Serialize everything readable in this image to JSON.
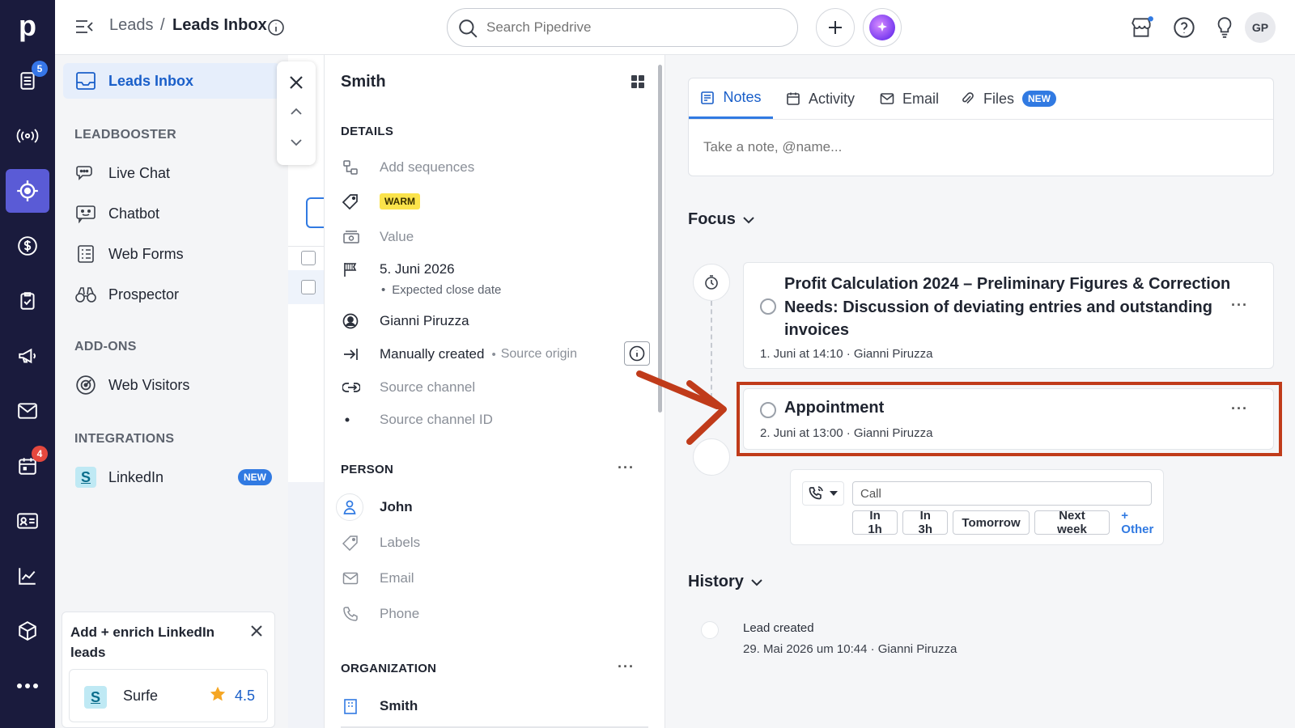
{
  "app": {
    "logo": "p",
    "colors": {
      "rail": "#1a1b3d",
      "rail_active": "#5a5bd6",
      "accent": "#317ae2",
      "badge": "#e5483e",
      "warm": "#fbe34b",
      "highlight": "#c03b1a"
    }
  },
  "rail": {
    "items": [
      {
        "icon": "leads-list-icon",
        "badge": "5",
        "badge_color": "#3676e8"
      },
      {
        "icon": "broadcast-icon"
      },
      {
        "icon": "target-icon",
        "active": true
      },
      {
        "icon": "dollar-icon"
      },
      {
        "icon": "clipboard-check-icon"
      },
      {
        "icon": "megaphone-icon"
      },
      {
        "icon": "mail-icon"
      },
      {
        "icon": "calendar-icon",
        "badge": "4",
        "badge_color": "#e5483e"
      },
      {
        "icon": "contact-card-icon"
      },
      {
        "icon": "chart-icon"
      },
      {
        "icon": "box-icon"
      },
      {
        "icon": "more-icon"
      }
    ]
  },
  "topbar": {
    "breadcrumb_parent": "Leads",
    "breadcrumb_sep": "/",
    "breadcrumb_current": "Leads Inbox",
    "search_placeholder": "Search Pipedrive",
    "avatar_initials": "GP"
  },
  "menu": {
    "inbox_label": "Leads Inbox",
    "leadbooster_heading": "LEADBOOSTER",
    "leadbooster_items": [
      "Live Chat",
      "Chatbot",
      "Web Forms",
      "Prospector"
    ],
    "addons_heading": "ADD-ONS",
    "addons_items": [
      "Web Visitors"
    ],
    "integrations_heading": "INTEGRATIONS",
    "integrations_items": [
      {
        "label": "LinkedIn",
        "badge": "NEW"
      }
    ],
    "promo": {
      "title": "Add + enrich LinkedIn leads",
      "app_name": "Surfe",
      "rating": "4.5"
    }
  },
  "details": {
    "title": "Smith",
    "details_heading": "DETAILS",
    "add_sequences": "Add sequences",
    "label_tag": "WARM",
    "value": "Value",
    "close_date": "5. Juni 2026",
    "close_date_caption": "Expected close date",
    "owner": "Gianni Piruzza",
    "source_origin": "Manually created",
    "source_origin_caption": "Source origin",
    "source_channel": "Source channel",
    "source_channel_id": "Source channel ID",
    "person_heading": "PERSON",
    "person_name": "John",
    "person_labels": "Labels",
    "person_email": "Email",
    "person_phone": "Phone",
    "org_heading": "ORGANIZATION",
    "org_name": "Smith"
  },
  "right": {
    "tabs": [
      {
        "label": "Notes",
        "active": true
      },
      {
        "label": "Activity"
      },
      {
        "label": "Email"
      },
      {
        "label": "Files",
        "badge": "NEW"
      }
    ],
    "note_placeholder": "Take a note, @name...",
    "focus_heading": "Focus",
    "activities": [
      {
        "title": "Profit Calculation 2024 – Preliminary Figures & Correction Needs: Discussion of deviating entries and outstanding invoices",
        "meta": "1. Juni at 14:10 · Gianni Piruzza"
      },
      {
        "title": "Appointment",
        "meta": "2. Juni at 13:00 · Gianni Piruzza"
      }
    ],
    "schedule": {
      "input_value": "Call",
      "buttons": [
        "In 1h",
        "In 3h",
        "Tomorrow",
        "Next week"
      ],
      "other_link": "+ Other"
    },
    "history_heading": "History",
    "history": [
      {
        "title": "Lead created",
        "meta": "29. Mai 2026 um 10:44 · Gianni Piruzza"
      }
    ]
  }
}
